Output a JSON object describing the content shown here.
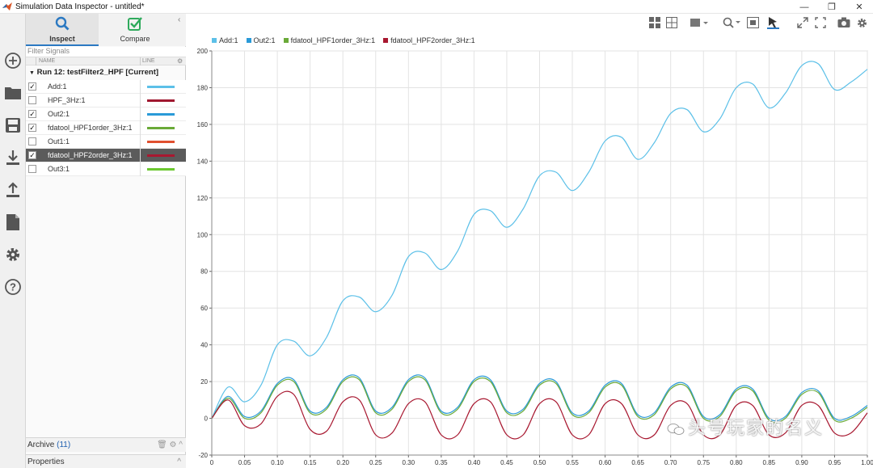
{
  "window": {
    "title": "Simulation Data Inspector - untitled*",
    "minimize": "—",
    "restore": "❐",
    "close": "✕"
  },
  "tabs": [
    {
      "label": "Inspect",
      "icon": "search-icon",
      "color": "#2b79c2"
    },
    {
      "label": "Compare",
      "icon": "compare-check-icon",
      "color": "#2eaa5c"
    }
  ],
  "filter": {
    "placeholder": "Filter Signals"
  },
  "columns": {
    "name": "NAME",
    "line": "LINE"
  },
  "run": {
    "label": "Run 12: testFilter2_HPF [Current]"
  },
  "signals": [
    {
      "name": "Add:1",
      "checked": true,
      "color": "#5cc0e8"
    },
    {
      "name": "HPF_3Hz:1",
      "checked": false,
      "color": "#a01830"
    },
    {
      "name": "Out2:1",
      "checked": true,
      "color": "#2a9ad8"
    },
    {
      "name": "fdatool_HPF1order_3Hz:1",
      "checked": true,
      "color": "#6aaa38"
    },
    {
      "name": "Out1:1",
      "checked": false,
      "color": "#e05030"
    },
    {
      "name": "fdatool_HPF2order_3Hz:1",
      "checked": true,
      "color": "#a81830",
      "selected": true
    },
    {
      "name": "Out3:1",
      "checked": false,
      "color": "#6cc830"
    }
  ],
  "archive": {
    "label": "Archive",
    "count": "(11)"
  },
  "properties": {
    "label": "Properties"
  },
  "watermark": "头号玩家的名义",
  "chart_data": {
    "type": "line",
    "xlim": [
      0,
      1
    ],
    "ylim": [
      -20,
      200
    ],
    "x_ticks": [
      "0",
      "0.05",
      "0.10",
      "0.15",
      "0.20",
      "0.25",
      "0.30",
      "0.35",
      "0.40",
      "0.45",
      "0.50",
      "0.55",
      "0.60",
      "0.65",
      "0.70",
      "0.75",
      "0.80",
      "0.85",
      "0.90",
      "0.95",
      "1.00"
    ],
    "y_ticks": [
      "-20",
      "0",
      "20",
      "40",
      "60",
      "80",
      "100",
      "120",
      "140",
      "160",
      "180",
      "200"
    ],
    "grid": true,
    "legend_position": "top-left",
    "series": [
      {
        "name": "Add:1",
        "color": "#5cc0e8",
        "x": [
          0,
          0.025,
          0.05,
          0.075,
          0.1,
          0.125,
          0.15,
          0.175,
          0.2,
          0.225,
          0.25,
          0.275,
          0.3,
          0.325,
          0.35,
          0.375,
          0.4,
          0.425,
          0.45,
          0.475,
          0.5,
          0.525,
          0.55,
          0.575,
          0.6,
          0.625,
          0.65,
          0.675,
          0.7,
          0.725,
          0.75,
          0.775,
          0.8,
          0.825,
          0.85,
          0.875,
          0.9,
          0.925,
          0.95,
          0.975,
          1.0
        ],
        "values": [
          0,
          17,
          9,
          18,
          40,
          42,
          34,
          44,
          64,
          66,
          58,
          67,
          88,
          90,
          81,
          91,
          111,
          113,
          104,
          114,
          132,
          134,
          124,
          134,
          151,
          153,
          141,
          150,
          166,
          168,
          156,
          163,
          180,
          182,
          169,
          177,
          192,
          193,
          179,
          183,
          190
        ]
      },
      {
        "name": "Out2:1",
        "color": "#2a9ad8",
        "x": [
          0,
          0.025,
          0.05,
          0.075,
          0.1,
          0.125,
          0.15,
          0.175,
          0.2,
          0.225,
          0.25,
          0.275,
          0.3,
          0.325,
          0.35,
          0.375,
          0.4,
          0.425,
          0.45,
          0.475,
          0.5,
          0.525,
          0.55,
          0.575,
          0.6,
          0.625,
          0.65,
          0.675,
          0.7,
          0.725,
          0.75,
          0.775,
          0.8,
          0.825,
          0.85,
          0.875,
          0.9,
          0.925,
          0.95,
          0.975,
          1.0
        ],
        "values": [
          0,
          12,
          1,
          4,
          19,
          21,
          4,
          6,
          21,
          22,
          4,
          6,
          21,
          22,
          4,
          6,
          21,
          21,
          4,
          5,
          19,
          20,
          3,
          4,
          18,
          19,
          2,
          3,
          17,
          18,
          1,
          2,
          16,
          16,
          0,
          1,
          14,
          15,
          0,
          1,
          7
        ]
      },
      {
        "name": "fdatool_HPF1order_3Hz:1",
        "color": "#6aaa38",
        "x": [
          0,
          0.025,
          0.05,
          0.075,
          0.1,
          0.125,
          0.15,
          0.175,
          0.2,
          0.225,
          0.25,
          0.275,
          0.3,
          0.325,
          0.35,
          0.375,
          0.4,
          0.425,
          0.45,
          0.475,
          0.5,
          0.525,
          0.55,
          0.575,
          0.6,
          0.625,
          0.65,
          0.675,
          0.7,
          0.725,
          0.75,
          0.775,
          0.8,
          0.825,
          0.85,
          0.875,
          0.9,
          0.925,
          0.95,
          0.975,
          1.0
        ],
        "values": [
          0,
          11,
          0,
          3,
          18,
          20,
          3,
          5,
          20,
          21,
          3,
          5,
          20,
          21,
          3,
          5,
          20,
          20,
          3,
          4,
          18,
          19,
          2,
          3,
          17,
          18,
          1,
          2,
          16,
          17,
          0,
          1,
          15,
          15,
          -1,
          0,
          13,
          14,
          -1,
          0,
          6
        ]
      },
      {
        "name": "fdatool_HPF2order_3Hz:1",
        "color": "#a81830",
        "x": [
          0,
          0.025,
          0.05,
          0.075,
          0.1,
          0.125,
          0.15,
          0.175,
          0.2,
          0.225,
          0.25,
          0.275,
          0.3,
          0.325,
          0.35,
          0.375,
          0.4,
          0.425,
          0.45,
          0.475,
          0.5,
          0.525,
          0.55,
          0.575,
          0.6,
          0.625,
          0.65,
          0.675,
          0.7,
          0.725,
          0.75,
          0.775,
          0.8,
          0.825,
          0.85,
          0.875,
          0.9,
          0.925,
          0.95,
          0.975,
          1.0
        ],
        "values": [
          0,
          10,
          -4,
          -3,
          12,
          13,
          -6,
          -7,
          9,
          10,
          -9,
          -8,
          8,
          9,
          -9,
          -9,
          8,
          9,
          -9,
          -9,
          8,
          9,
          -9,
          -9,
          8,
          8,
          -9,
          -9,
          7,
          8,
          -9,
          -9,
          7,
          7,
          -9,
          -8,
          7,
          7,
          -8,
          -8,
          3
        ]
      }
    ]
  }
}
